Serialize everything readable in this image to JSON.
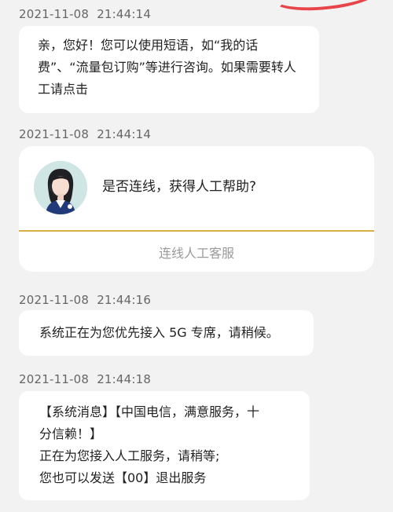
{
  "messages": [
    {
      "date": "2021-11-08",
      "time": "21:44:14",
      "text": "亲，您好！您可以使用短语，如“我的话费”、“流量包订购”等进行咨询。如果需要转人工请点击"
    },
    {
      "date": "2021-11-08",
      "time": "21:44:14",
      "question": "是否连线，获得人工帮助?",
      "action_label": "连线人工客服"
    },
    {
      "date": "2021-11-08",
      "time": "21:44:16",
      "text": "系统正在为您优先接入 5G 专席，请稍候。"
    },
    {
      "date": "2021-11-08",
      "time": "21:44:18",
      "lines": [
        "【系统消息】【中国电信，满意服务，十",
        "分信赖！】",
        "正在为您接入人工服务，请稍等;",
        "您也可以发送【00】退出服务"
      ]
    }
  ],
  "colors": {
    "background": "#f2f2f2",
    "bubble": "#ffffff",
    "divider": "#d9ad48",
    "timestamp": "#666666",
    "action_text": "#9a9a9a",
    "top_mark": "#e8454a"
  },
  "icons": {
    "agent_avatar": "customer-service-agent-avatar"
  }
}
